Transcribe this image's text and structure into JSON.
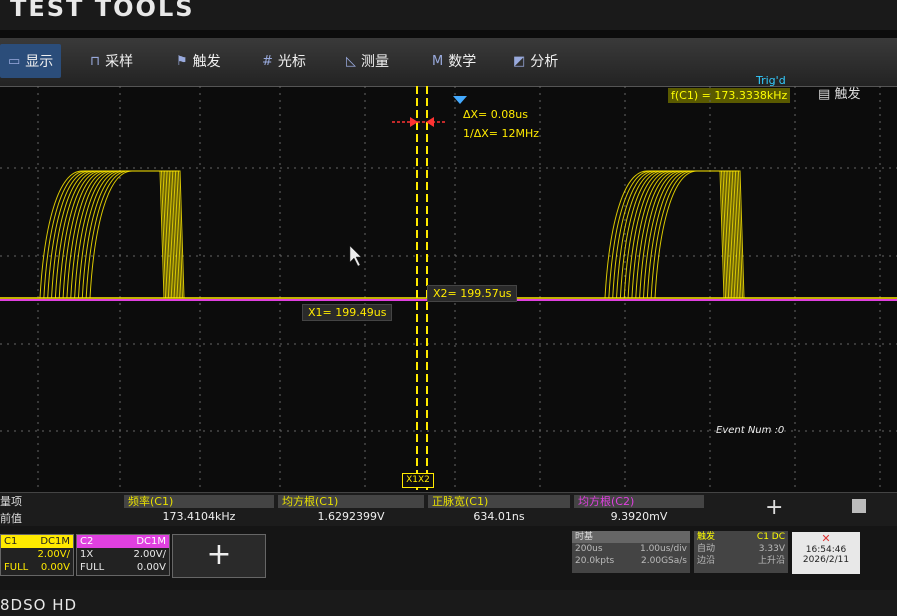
{
  "device": {
    "title": "TEST TOOLS",
    "model": "8DSO HD"
  },
  "menu": [
    {
      "label": "显示",
      "icon": "display-icon"
    },
    {
      "label": "采样",
      "icon": "sample-icon"
    },
    {
      "label": "触发",
      "icon": "flag-icon"
    },
    {
      "label": "光标",
      "icon": "cursor-grid-icon"
    },
    {
      "label": "测量",
      "icon": "measure-icon"
    },
    {
      "label": "数学",
      "icon": "math-icon"
    },
    {
      "label": "分析",
      "icon": "analysis-icon"
    }
  ],
  "trigger": {
    "status": "Trig'd",
    "frequency": "f(C1) = 173.3338kHz",
    "menu_label": "触发"
  },
  "cursors": {
    "delta_x": "ΔX= 0.08us",
    "inv_delta_x": "1/ΔX= 12MHz",
    "x1": "X1= 199.49us",
    "x2": "X2= 199.57us",
    "tag": "X1X2"
  },
  "event_num": "Event Num :0",
  "measure": {
    "row_label_top": "量项",
    "row_label_bottom": "前值",
    "cols": [
      {
        "head": "频率(C1)",
        "value": "173.4104kHz"
      },
      {
        "head": "均方根(C1)",
        "value": "1.6292399V"
      },
      {
        "head": "正脉宽(C1)",
        "value": "634.01ns"
      },
      {
        "head": "均方根(C2)",
        "value": "9.3920mV"
      }
    ],
    "add_symbol": "+"
  },
  "channels": [
    {
      "name": "C1",
      "coupling": "DC1M",
      "scale": "2.00V/",
      "probe": "",
      "bw": "FULL",
      "offset": "0.00V",
      "color": "#ffea00"
    },
    {
      "name": "C2",
      "coupling": "DC1M",
      "scale": "2.00V/",
      "probe": "1X",
      "bw": "FULL",
      "offset": "0.00V",
      "color": "#e040e0"
    }
  ],
  "add_channel_symbol": "+",
  "timebase": {
    "title": "时基",
    "scale": "200us",
    "sample_rate": "1.00us/div",
    "points": "20.0kpts",
    "gsa": "2.00GSa/s"
  },
  "trigger_panel": {
    "title": "触发",
    "mode": "自动",
    "level": "C1 DC",
    "edge": "上升沿",
    "src": "边沿",
    "voltage": "3.33V"
  },
  "clock": {
    "time": "16:54:46",
    "date": "2026/2/11"
  },
  "colors": {
    "ch1": "#ffea00",
    "ch2": "#e040e0",
    "accent": "#2b4d7a"
  }
}
